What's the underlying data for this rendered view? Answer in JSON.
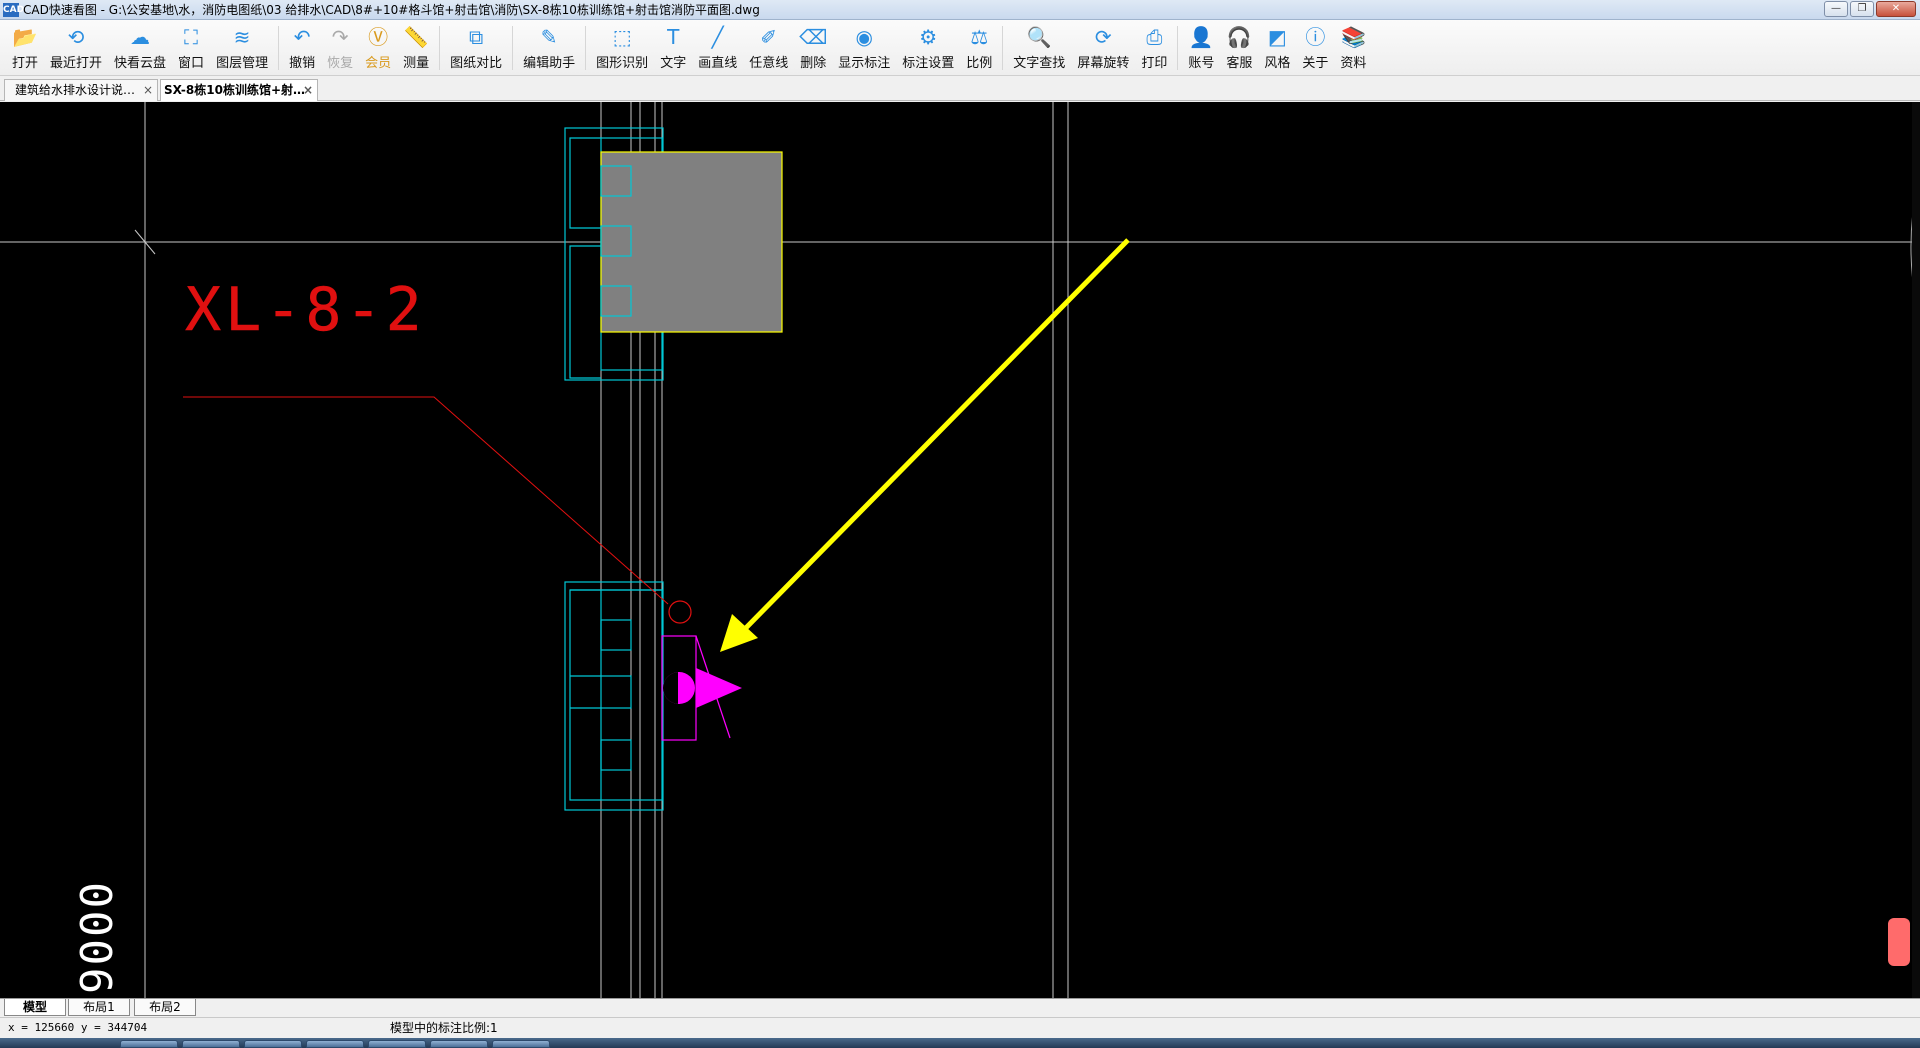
{
  "window": {
    "app_icon_text": "CAD",
    "title": "CAD快速看图 - G:\\公安基地\\水，消防电图纸\\03 给排水\\CAD\\8#+10#格斗馆+射击馆\\消防\\SX-8栋10栋训练馆+射击馆消防平面图.dwg",
    "minimize": "—",
    "restore": "❐",
    "close": "✕"
  },
  "toolbar": {
    "items": [
      {
        "label": "打开",
        "icon": "folder-open-icon",
        "glyph": "📂"
      },
      {
        "label": "最近打开",
        "icon": "history-icon",
        "glyph": "⟲"
      },
      {
        "label": "快看云盘",
        "icon": "cloud-icon",
        "glyph": "☁"
      },
      {
        "label": "窗口",
        "icon": "window-zoom-icon",
        "glyph": "⛶"
      },
      {
        "label": "图层管理",
        "icon": "layers-icon",
        "glyph": "≋"
      },
      {
        "label": "撤销",
        "icon": "undo-icon",
        "glyph": "↶"
      },
      {
        "label": "恢复",
        "icon": "redo-icon",
        "glyph": "↷"
      },
      {
        "label": "会员",
        "icon": "vip-icon",
        "glyph": "Ⓥ"
      },
      {
        "label": "测量",
        "icon": "ruler-icon",
        "glyph": "📏"
      },
      {
        "label": "图纸对比",
        "icon": "compare-icon",
        "glyph": "⧉"
      },
      {
        "label": "编辑助手",
        "icon": "edit-helper-icon",
        "glyph": "✎"
      },
      {
        "label": "图形识别",
        "icon": "shape-recognize-icon",
        "glyph": "⬚"
      },
      {
        "label": "文字",
        "icon": "text-icon",
        "glyph": "T"
      },
      {
        "label": "画直线",
        "icon": "line-icon",
        "glyph": "╱"
      },
      {
        "label": "任意线",
        "icon": "freehand-icon",
        "glyph": "✐"
      },
      {
        "label": "删除",
        "icon": "eraser-icon",
        "glyph": "⌫"
      },
      {
        "label": "显示标注",
        "icon": "eye-icon",
        "glyph": "◉"
      },
      {
        "label": "标注设置",
        "icon": "annotation-settings-icon",
        "glyph": "⚙"
      },
      {
        "label": "比例",
        "icon": "scale-icon",
        "glyph": "⚖"
      },
      {
        "label": "文字查找",
        "icon": "text-search-icon",
        "glyph": "🔍"
      },
      {
        "label": "屏幕旋转",
        "icon": "rotate-icon",
        "glyph": "⟳"
      },
      {
        "label": "打印",
        "icon": "printer-icon",
        "glyph": "⎙"
      },
      {
        "label": "账号",
        "icon": "user-icon",
        "glyph": "👤"
      },
      {
        "label": "客服",
        "icon": "headset-icon",
        "glyph": "🎧"
      },
      {
        "label": "风格",
        "icon": "style-icon",
        "glyph": "◩"
      },
      {
        "label": "关于",
        "icon": "info-icon",
        "glyph": "ⓘ"
      },
      {
        "label": "资料",
        "icon": "docs-icon",
        "glyph": "📚"
      }
    ]
  },
  "doc_tabs": [
    {
      "label": "建筑给水排水设计说…",
      "close": "×"
    },
    {
      "label": "SX-8栋10栋训练馆+射…",
      "close": "×"
    }
  ],
  "drawing": {
    "pipe_label": "XL-8-2",
    "dimension_text": "9000",
    "colors": {
      "background": "#000000",
      "grid_line": "#c8c8c8",
      "cyan": "#00c8d6",
      "yellow": "#ffff00",
      "red": "#e01010",
      "magenta": "#ff00ff",
      "gray_fill": "#808080"
    }
  },
  "layout_tabs": [
    "模型",
    "布局1",
    "布局2"
  ],
  "status": {
    "coords": "x = 125660  y = 344704",
    "scale": "模型中的标注比例:1"
  }
}
